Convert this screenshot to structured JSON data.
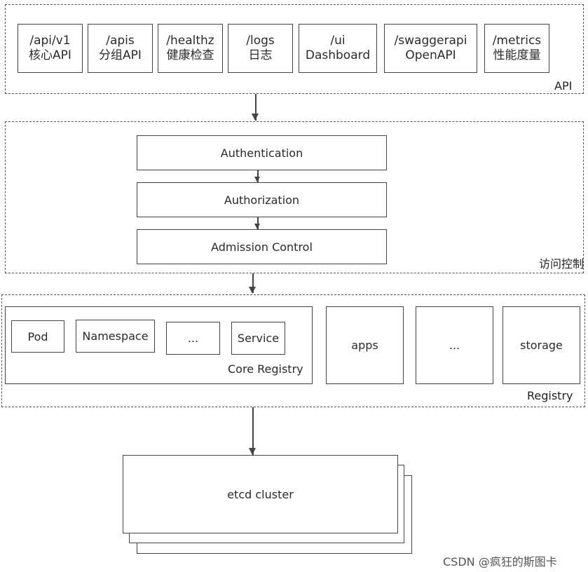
{
  "api_group": {
    "label": "API",
    "endpoints": [
      {
        "path": "/api/v1",
        "desc": "核心API"
      },
      {
        "path": "/apis",
        "desc": "分组API"
      },
      {
        "path": "/healthz",
        "desc": "健康检查"
      },
      {
        "path": "/logs",
        "desc": "日志"
      },
      {
        "path": "/ui",
        "desc": "Dashboard"
      },
      {
        "path": "/swaggerapi",
        "desc": "OpenAPI"
      },
      {
        "path": "/metrics",
        "desc": "性能度量"
      }
    ]
  },
  "access_control": {
    "label": "访问控制",
    "steps": [
      "Authentication",
      "Authorization",
      "Admission Control"
    ]
  },
  "registry": {
    "label": "Registry",
    "core": {
      "label": "Core Registry",
      "items": [
        "Pod",
        "Namespace",
        "...",
        "Service"
      ]
    },
    "groups": [
      "apps",
      "...",
      "storage"
    ]
  },
  "etcd": {
    "label": "etcd cluster"
  },
  "watermark": "CSDN @疯狂的斯图卡"
}
